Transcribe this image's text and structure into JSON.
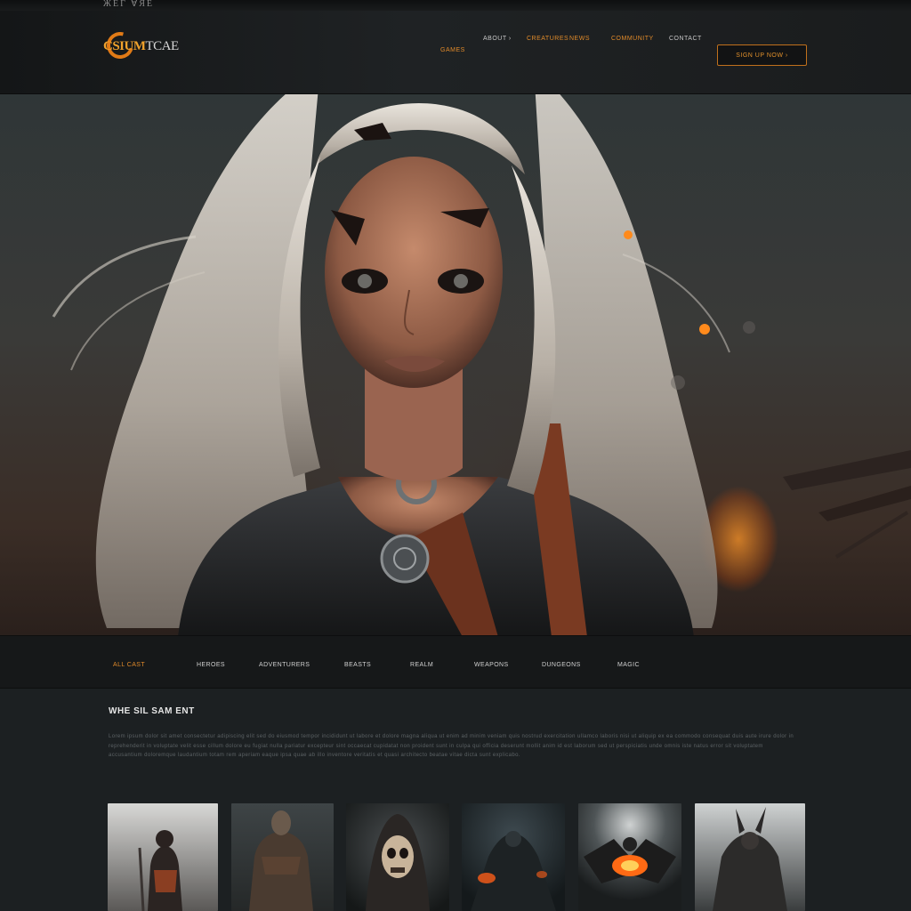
{
  "top_strip": {
    "text": "ЖЕГ ∀ЯЕ"
  },
  "header": {
    "logo": {
      "bold": "CSIUM",
      "light": "TCAE",
      "icon": "crest-logo-icon"
    },
    "nav": [
      {
        "label": "GAMES",
        "style": "active"
      },
      {
        "label": "ABOUT ›",
        "style": "normal"
      },
      {
        "label": "CREATURES",
        "style": "orange"
      },
      {
        "label": "NEWS",
        "style": "orange"
      },
      {
        "label": "COMMUNITY",
        "style": "orange"
      },
      {
        "label": "CONTACT",
        "style": "normal"
      }
    ],
    "cta_label": "SIGN UP NOW ›"
  },
  "category_bar": {
    "items": [
      {
        "label": "ALL CAST",
        "active": true
      },
      {
        "label": "HEROES",
        "active": false
      },
      {
        "label": "ADVENTURERS",
        "active": false
      },
      {
        "label": "BEASTS",
        "active": false
      },
      {
        "label": "REALM",
        "active": false
      },
      {
        "label": "WEAPONS",
        "active": false
      },
      {
        "label": "DUNGEONS",
        "active": false
      },
      {
        "label": "MAGIC",
        "active": false
      }
    ]
  },
  "about": {
    "title": "WHE SIL SAM ENT",
    "body": "Lorem ipsum dolor sit amet consectetur adipiscing elit sed do eiusmod tempor incididunt ut labore et dolore magna aliqua ut enim ad minim veniam quis nostrud exercitation ullamco laboris nisi ut aliquip ex ea commodo consequat duis aute irure dolor in reprehenderit in voluptate velit esse cillum dolore eu fugiat nulla pariatur excepteur sint occaecat cupidatat non proident sunt in culpa qui officia deserunt mollit anim id est laborum sed ut perspiciatis unde omnis iste natus error sit voluptatem accusantium doloremque laudantium totam rem aperiam eaque ipsa quae ab illo inventore veritatis et quasi architecto beatae vitae dicta sunt explicabo."
  },
  "gallery": {
    "items": [
      {
        "name": "hooded-warrior"
      },
      {
        "name": "armored-brute"
      },
      {
        "name": "skull-wraith"
      },
      {
        "name": "dark-knight"
      },
      {
        "name": "fire-demon"
      },
      {
        "name": "horned-beast"
      }
    ]
  },
  "colors": {
    "accent": "#e08a2a",
    "background": "#1c2022",
    "header": "#1a1c1d",
    "fire": "#ff8a1c"
  }
}
